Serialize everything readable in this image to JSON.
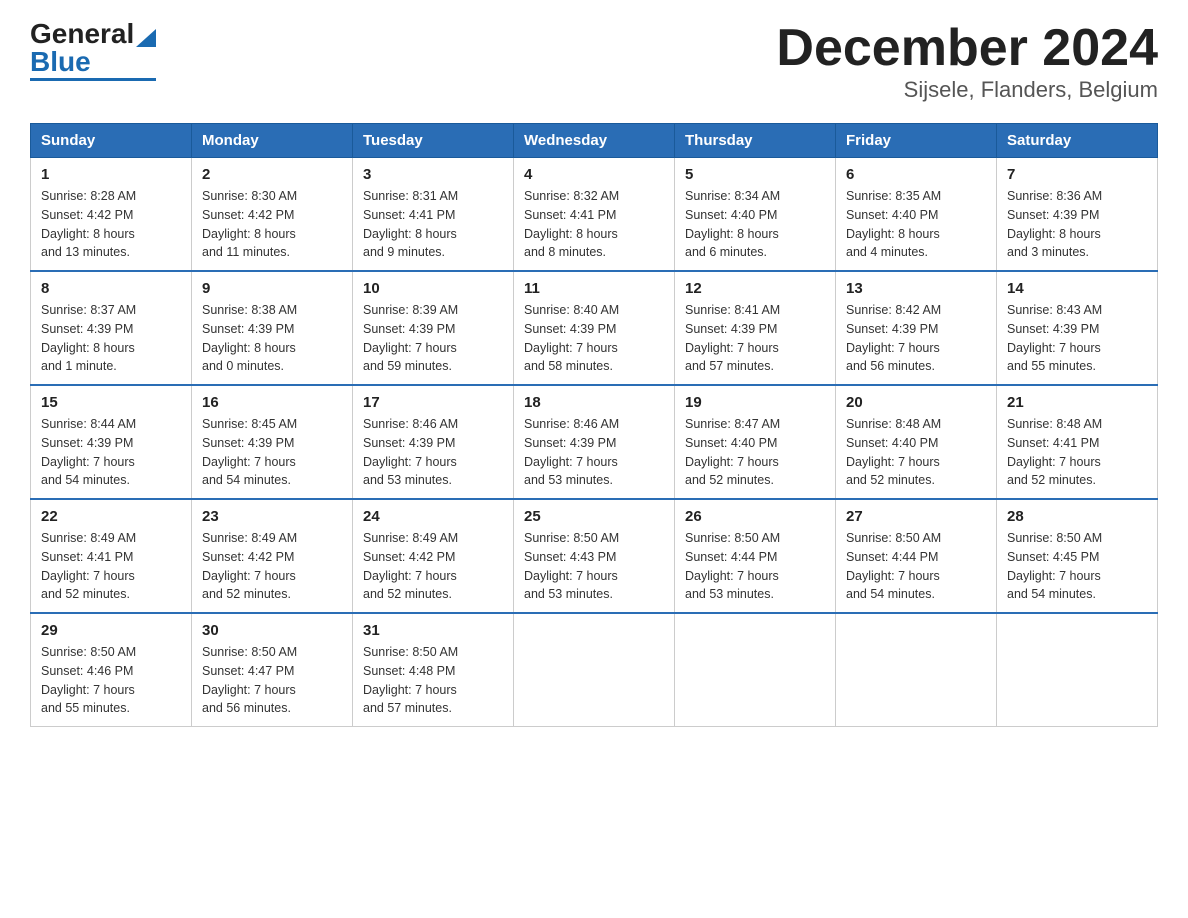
{
  "header": {
    "logo_general": "General",
    "logo_blue": "Blue",
    "title": "December 2024",
    "subtitle": "Sijsele, Flanders, Belgium"
  },
  "weekdays": [
    "Sunday",
    "Monday",
    "Tuesday",
    "Wednesday",
    "Thursday",
    "Friday",
    "Saturday"
  ],
  "weeks": [
    [
      {
        "day": "1",
        "info": "Sunrise: 8:28 AM\nSunset: 4:42 PM\nDaylight: 8 hours\nand 13 minutes."
      },
      {
        "day": "2",
        "info": "Sunrise: 8:30 AM\nSunset: 4:42 PM\nDaylight: 8 hours\nand 11 minutes."
      },
      {
        "day": "3",
        "info": "Sunrise: 8:31 AM\nSunset: 4:41 PM\nDaylight: 8 hours\nand 9 minutes."
      },
      {
        "day": "4",
        "info": "Sunrise: 8:32 AM\nSunset: 4:41 PM\nDaylight: 8 hours\nand 8 minutes."
      },
      {
        "day": "5",
        "info": "Sunrise: 8:34 AM\nSunset: 4:40 PM\nDaylight: 8 hours\nand 6 minutes."
      },
      {
        "day": "6",
        "info": "Sunrise: 8:35 AM\nSunset: 4:40 PM\nDaylight: 8 hours\nand 4 minutes."
      },
      {
        "day": "7",
        "info": "Sunrise: 8:36 AM\nSunset: 4:39 PM\nDaylight: 8 hours\nand 3 minutes."
      }
    ],
    [
      {
        "day": "8",
        "info": "Sunrise: 8:37 AM\nSunset: 4:39 PM\nDaylight: 8 hours\nand 1 minute."
      },
      {
        "day": "9",
        "info": "Sunrise: 8:38 AM\nSunset: 4:39 PM\nDaylight: 8 hours\nand 0 minutes."
      },
      {
        "day": "10",
        "info": "Sunrise: 8:39 AM\nSunset: 4:39 PM\nDaylight: 7 hours\nand 59 minutes."
      },
      {
        "day": "11",
        "info": "Sunrise: 8:40 AM\nSunset: 4:39 PM\nDaylight: 7 hours\nand 58 minutes."
      },
      {
        "day": "12",
        "info": "Sunrise: 8:41 AM\nSunset: 4:39 PM\nDaylight: 7 hours\nand 57 minutes."
      },
      {
        "day": "13",
        "info": "Sunrise: 8:42 AM\nSunset: 4:39 PM\nDaylight: 7 hours\nand 56 minutes."
      },
      {
        "day": "14",
        "info": "Sunrise: 8:43 AM\nSunset: 4:39 PM\nDaylight: 7 hours\nand 55 minutes."
      }
    ],
    [
      {
        "day": "15",
        "info": "Sunrise: 8:44 AM\nSunset: 4:39 PM\nDaylight: 7 hours\nand 54 minutes."
      },
      {
        "day": "16",
        "info": "Sunrise: 8:45 AM\nSunset: 4:39 PM\nDaylight: 7 hours\nand 54 minutes."
      },
      {
        "day": "17",
        "info": "Sunrise: 8:46 AM\nSunset: 4:39 PM\nDaylight: 7 hours\nand 53 minutes."
      },
      {
        "day": "18",
        "info": "Sunrise: 8:46 AM\nSunset: 4:39 PM\nDaylight: 7 hours\nand 53 minutes."
      },
      {
        "day": "19",
        "info": "Sunrise: 8:47 AM\nSunset: 4:40 PM\nDaylight: 7 hours\nand 52 minutes."
      },
      {
        "day": "20",
        "info": "Sunrise: 8:48 AM\nSunset: 4:40 PM\nDaylight: 7 hours\nand 52 minutes."
      },
      {
        "day": "21",
        "info": "Sunrise: 8:48 AM\nSunset: 4:41 PM\nDaylight: 7 hours\nand 52 minutes."
      }
    ],
    [
      {
        "day": "22",
        "info": "Sunrise: 8:49 AM\nSunset: 4:41 PM\nDaylight: 7 hours\nand 52 minutes."
      },
      {
        "day": "23",
        "info": "Sunrise: 8:49 AM\nSunset: 4:42 PM\nDaylight: 7 hours\nand 52 minutes."
      },
      {
        "day": "24",
        "info": "Sunrise: 8:49 AM\nSunset: 4:42 PM\nDaylight: 7 hours\nand 52 minutes."
      },
      {
        "day": "25",
        "info": "Sunrise: 8:50 AM\nSunset: 4:43 PM\nDaylight: 7 hours\nand 53 minutes."
      },
      {
        "day": "26",
        "info": "Sunrise: 8:50 AM\nSunset: 4:44 PM\nDaylight: 7 hours\nand 53 minutes."
      },
      {
        "day": "27",
        "info": "Sunrise: 8:50 AM\nSunset: 4:44 PM\nDaylight: 7 hours\nand 54 minutes."
      },
      {
        "day": "28",
        "info": "Sunrise: 8:50 AM\nSunset: 4:45 PM\nDaylight: 7 hours\nand 54 minutes."
      }
    ],
    [
      {
        "day": "29",
        "info": "Sunrise: 8:50 AM\nSunset: 4:46 PM\nDaylight: 7 hours\nand 55 minutes."
      },
      {
        "day": "30",
        "info": "Sunrise: 8:50 AM\nSunset: 4:47 PM\nDaylight: 7 hours\nand 56 minutes."
      },
      {
        "day": "31",
        "info": "Sunrise: 8:50 AM\nSunset: 4:48 PM\nDaylight: 7 hours\nand 57 minutes."
      },
      {
        "day": "",
        "info": ""
      },
      {
        "day": "",
        "info": ""
      },
      {
        "day": "",
        "info": ""
      },
      {
        "day": "",
        "info": ""
      }
    ]
  ]
}
